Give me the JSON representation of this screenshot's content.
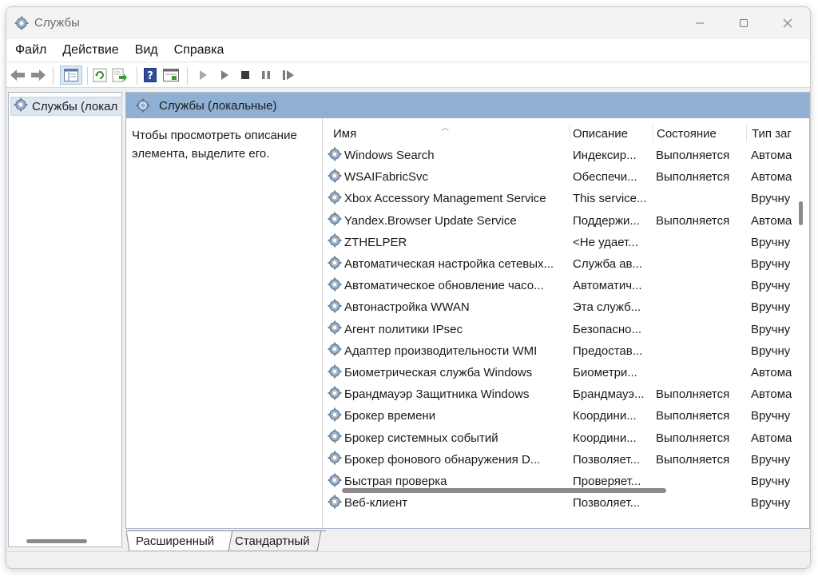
{
  "window": {
    "title": "Службы"
  },
  "menu": [
    "Файл",
    "Действие",
    "Вид",
    "Справка"
  ],
  "tree": {
    "item_label": "Службы (локал"
  },
  "pane": {
    "header": "Службы (локальные)",
    "description": "Чтобы просмотреть описание элемента, выделите его."
  },
  "columns": {
    "name": "Имя",
    "description": "Описание",
    "state": "Состояние",
    "type": "Тип заг"
  },
  "rows": [
    {
      "name": "Windows Search",
      "description": "Индексир...",
      "state": "Выполняется",
      "type": "Автома"
    },
    {
      "name": "WSAIFabricSvc",
      "description": "Обеспечи...",
      "state": "Выполняется",
      "type": "Автома"
    },
    {
      "name": "Xbox Accessory Management Service",
      "description": "This service...",
      "state": "",
      "type": "Вручну"
    },
    {
      "name": "Yandex.Browser Update Service",
      "description": "Поддержи...",
      "state": "Выполняется",
      "type": "Автома"
    },
    {
      "name": "ZTHELPER",
      "description": "<Не удает...",
      "state": "",
      "type": "Вручну"
    },
    {
      "name": "Автоматическая настройка сетевых...",
      "description": "Служба ав...",
      "state": "",
      "type": "Вручну"
    },
    {
      "name": "Автоматическое обновление часо...",
      "description": "Автоматич...",
      "state": "",
      "type": "Вручну"
    },
    {
      "name": "Автонастройка WWAN",
      "description": "Эта служб...",
      "state": "",
      "type": "Вручну"
    },
    {
      "name": "Агент политики IPsec",
      "description": "Безопасно...",
      "state": "",
      "type": "Вручну"
    },
    {
      "name": "Адаптер производительности WMI",
      "description": "Предостав...",
      "state": "",
      "type": "Вручну"
    },
    {
      "name": "Биометрическая служба Windows",
      "description": "Биометри...",
      "state": "",
      "type": "Автома"
    },
    {
      "name": "Брандмауэр Защитника Windows",
      "description": "Брандмауэ...",
      "state": "Выполняется",
      "type": "Автома"
    },
    {
      "name": "Брокер времени",
      "description": "Координи...",
      "state": "Выполняется",
      "type": "Вручну"
    },
    {
      "name": "Брокер системных событий",
      "description": "Координи...",
      "state": "Выполняется",
      "type": "Автома"
    },
    {
      "name": "Брокер фонового обнаружения D...",
      "description": "Позволяет...",
      "state": "Выполняется",
      "type": "Вручну"
    },
    {
      "name": "Быстрая проверка",
      "description": "Проверяет...",
      "state": "",
      "type": "Вручну"
    },
    {
      "name": "Веб-клиент",
      "description": "Позволяет...",
      "state": "",
      "type": "Вручну"
    }
  ],
  "tabs": {
    "extended": "Расширенный",
    "standard": "Стандартный"
  },
  "icons": {
    "back": "back-arrow-icon",
    "forward": "forward-arrow-icon",
    "console_tree": "console-tree-icon",
    "refresh": "refresh-icon",
    "export": "export-list-icon",
    "help": "help-icon",
    "properties": "properties-icon",
    "start": "play-icon",
    "start_alt": "play-icon",
    "stop": "stop-icon",
    "pause": "pause-icon",
    "resume": "resume-icon"
  },
  "colors": {
    "pane_header": "#8fafd3",
    "selection": "#dde7f1"
  }
}
